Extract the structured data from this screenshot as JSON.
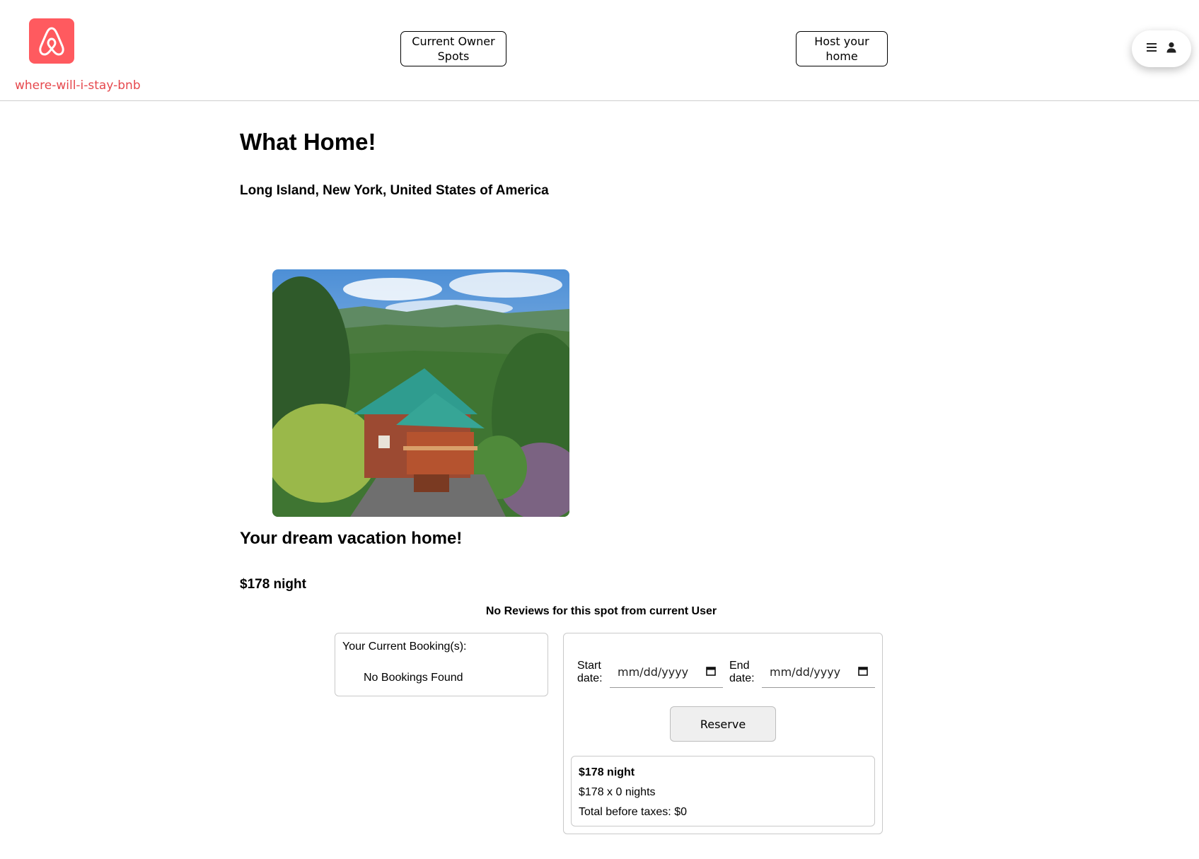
{
  "header": {
    "brand_name": "where-will-i-stay-bnb",
    "brand_color": "#ff5a5f",
    "logo_icon": "airbnb-logo-icon",
    "nav": {
      "owner_spots_label": "Current Owner Spots",
      "host_home_label": "Host your home"
    },
    "user_menu": {
      "menu_icon": "hamburger-menu-icon",
      "user_icon": "user-icon"
    }
  },
  "spot": {
    "name": "What Home!",
    "location": "Long Island, New York, United States of America",
    "description": "Your dream vacation home!",
    "price_label": "$178 night",
    "reviews_message": "No Reviews for this spot from current User"
  },
  "bookings": {
    "label": "Your Current Booking(s):",
    "empty_message": "No Bookings Found"
  },
  "reserve": {
    "start_label": "Start date:",
    "end_label": "End date:",
    "start_placeholder": "mm/dd/yyyy",
    "end_placeholder": "mm/dd/yyyy",
    "calendar_icon": "calendar-icon",
    "button_label": "Reserve",
    "summary": {
      "price_per_night": "$178 night",
      "nights_calc": "$178 x 0 nights",
      "total": "Total before taxes: $0"
    }
  }
}
